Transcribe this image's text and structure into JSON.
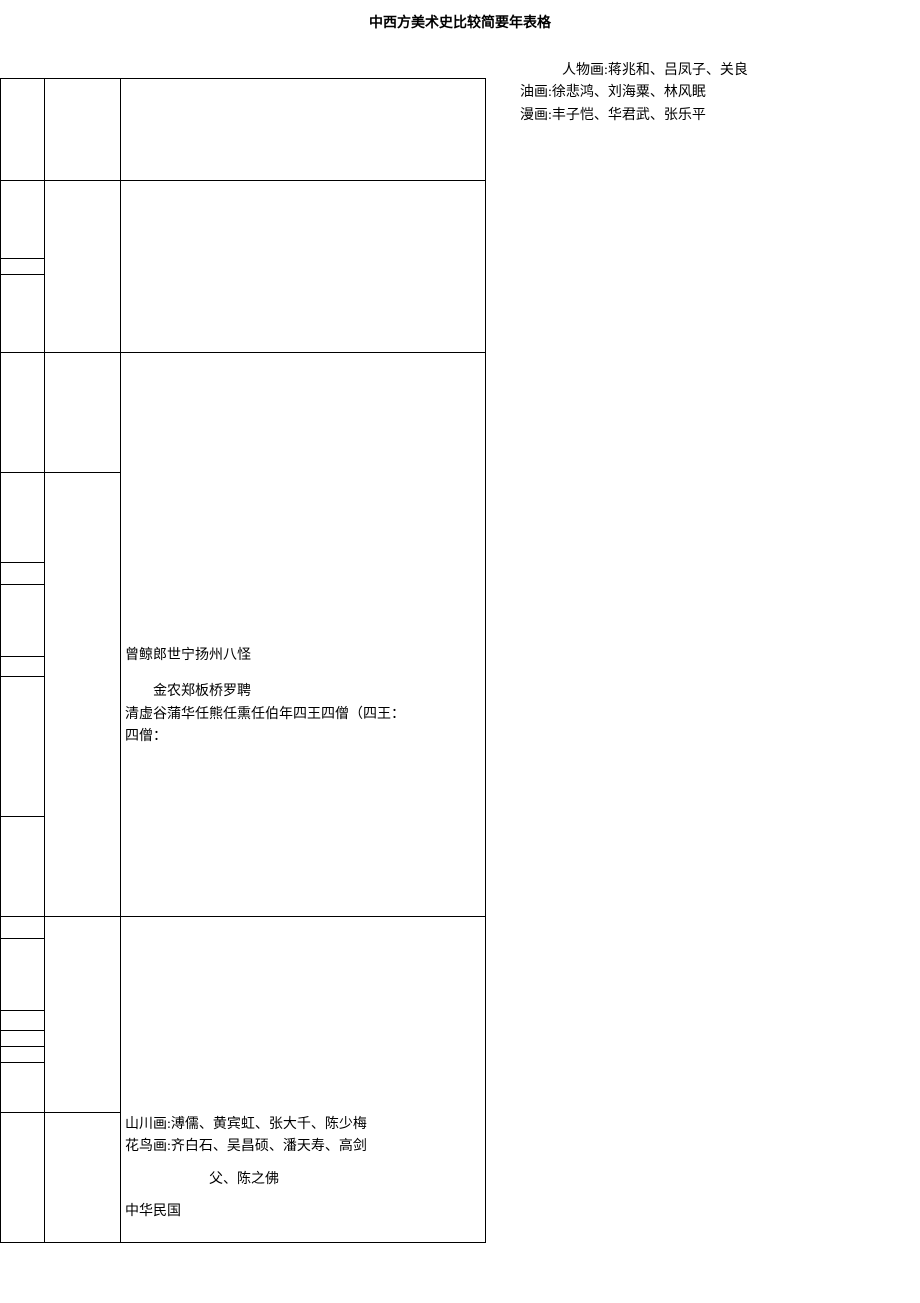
{
  "title": "中西方美术史比较简要年表格",
  "side_text": {
    "line1": "人物画:蒋兆和、吕凤子、关良",
    "line2": "油画:徐悲鸿、刘海粟、林风眠",
    "line3": "漫画:丰子恺、华君武、张乐平"
  },
  "content_block_a": {
    "line1": "曾鲸郎世宁扬州八怪",
    "line2": "金农郑板桥罗聘",
    "line3": "清虚谷蒲华任熊任熏任伯年四王四僧（四王：",
    "line4": "四僧："
  },
  "content_block_b": {
    "line1": "山川画:溥儒、黄宾虹、张大千、陈少梅",
    "line2": "花鸟画:齐白石、吴昌硕、潘天寿、高剑",
    "line3": "父、陈之佛",
    "line4": "中华民国"
  }
}
